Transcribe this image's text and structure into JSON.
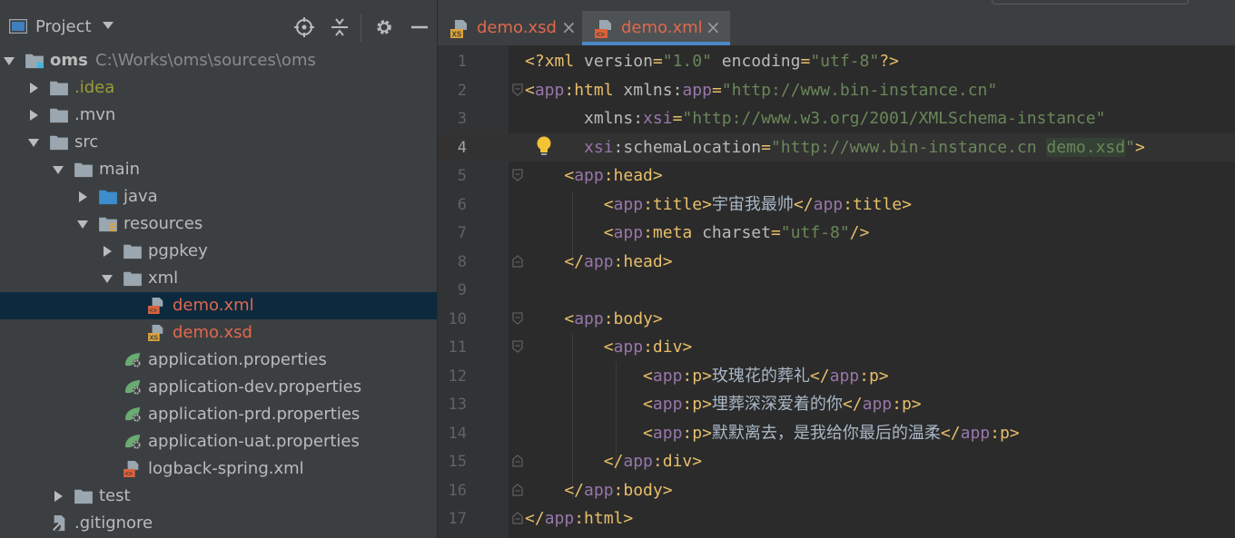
{
  "project_panel": {
    "title": "Project",
    "tree": [
      {
        "label": "oms",
        "path": "C:\\Works\\oms\\sources\\oms",
        "icon": "module-folder-icon",
        "expanded": true
      },
      {
        "label": ".idea",
        "icon": "folder-icon",
        "expanded": false
      },
      {
        "label": ".mvn",
        "icon": "folder-icon",
        "expanded": false
      },
      {
        "label": "src",
        "icon": "folder-icon",
        "expanded": true
      },
      {
        "label": "main",
        "icon": "folder-icon",
        "expanded": true
      },
      {
        "label": "java",
        "icon": "source-folder-icon",
        "expanded": false
      },
      {
        "label": "resources",
        "icon": "resources-folder-icon",
        "expanded": true
      },
      {
        "label": "pgpkey",
        "icon": "folder-icon",
        "expanded": false
      },
      {
        "label": "xml",
        "icon": "folder-icon",
        "expanded": true
      },
      {
        "label": "demo.xml",
        "icon": "xml-file-icon"
      },
      {
        "label": "demo.xsd",
        "icon": "xsd-file-icon"
      },
      {
        "label": "application.properties",
        "icon": "spring-properties-icon"
      },
      {
        "label": "application-dev.properties",
        "icon": "spring-properties-icon"
      },
      {
        "label": "application-prd.properties",
        "icon": "spring-properties-icon"
      },
      {
        "label": "application-uat.properties",
        "icon": "spring-properties-icon"
      },
      {
        "label": "logback-spring.xml",
        "icon": "xml-file-icon"
      },
      {
        "label": "test",
        "icon": "folder-icon",
        "expanded": false
      },
      {
        "label": ".gitignore",
        "icon": "gitignore-file-icon"
      }
    ],
    "selected": "demo.xml"
  },
  "editor": {
    "tabs": [
      {
        "label": "demo.xsd",
        "icon": "xsd-file-icon",
        "close": "×",
        "active": false
      },
      {
        "label": "demo.xml",
        "icon": "xml-file-icon",
        "close": "×",
        "active": true
      }
    ],
    "current_line": 4,
    "lines": [
      {
        "n": "1",
        "tokens": [
          [
            "br",
            "<?"
          ],
          [
            "br",
            "xml "
          ],
          [
            "attr",
            "version"
          ],
          [
            "br",
            "="
          ],
          [
            "val",
            "\"1.0\""
          ],
          [
            "attr",
            " encoding"
          ],
          [
            "br",
            "="
          ],
          [
            "val",
            "\"utf-8\""
          ],
          [
            "br",
            "?>"
          ]
        ]
      },
      {
        "n": "2",
        "tokens": [
          [
            "br",
            "<"
          ],
          [
            "ns",
            "app"
          ],
          [
            "br",
            ":html "
          ],
          [
            "attr",
            "xmlns:"
          ],
          [
            "ns",
            "app"
          ],
          [
            "br",
            "="
          ],
          [
            "val",
            "\"http://www.bin-instance.cn\""
          ]
        ]
      },
      {
        "n": "3",
        "tokens": [
          [
            "attr",
            "      xmlns:"
          ],
          [
            "ns",
            "xsi"
          ],
          [
            "br",
            "="
          ],
          [
            "val",
            "\"http://www.w3.org/2001/XMLSchema-instance\""
          ]
        ]
      },
      {
        "n": "4",
        "tokens": [
          [
            "attr",
            "      "
          ],
          [
            "ns",
            "xsi"
          ],
          [
            "attr",
            ":schemaLocation"
          ],
          [
            "br",
            "="
          ],
          [
            "val",
            "\"http://www.bin-instance.cn "
          ],
          [
            "valhl",
            "demo.xsd"
          ],
          [
            "val",
            "\""
          ],
          [
            "br",
            ">"
          ]
        ]
      },
      {
        "n": "5",
        "tokens": [
          [
            "br",
            "    <"
          ],
          [
            "ns",
            "app"
          ],
          [
            "br",
            ":head>"
          ]
        ]
      },
      {
        "n": "6",
        "tokens": [
          [
            "br",
            "        <"
          ],
          [
            "ns",
            "app"
          ],
          [
            "br",
            ":title>"
          ],
          [
            "txt",
            "宇宙我最帅"
          ],
          [
            "br",
            "</"
          ],
          [
            "ns",
            "app"
          ],
          [
            "br",
            ":title>"
          ]
        ]
      },
      {
        "n": "7",
        "tokens": [
          [
            "br",
            "        <"
          ],
          [
            "ns",
            "app"
          ],
          [
            "br",
            ":meta "
          ],
          [
            "attr",
            "charset"
          ],
          [
            "br",
            "="
          ],
          [
            "val",
            "\"utf-8\""
          ],
          [
            "br",
            "/>"
          ]
        ]
      },
      {
        "n": "8",
        "tokens": [
          [
            "br",
            "    </"
          ],
          [
            "ns",
            "app"
          ],
          [
            "br",
            ":head>"
          ]
        ]
      },
      {
        "n": "9",
        "tokens": []
      },
      {
        "n": "10",
        "tokens": [
          [
            "br",
            "    <"
          ],
          [
            "ns",
            "app"
          ],
          [
            "br",
            ":body>"
          ]
        ]
      },
      {
        "n": "11",
        "tokens": [
          [
            "br",
            "        <"
          ],
          [
            "ns",
            "app"
          ],
          [
            "br",
            ":div>"
          ]
        ]
      },
      {
        "n": "12",
        "tokens": [
          [
            "br",
            "            <"
          ],
          [
            "ns",
            "app"
          ],
          [
            "br",
            ":p>"
          ],
          [
            "txt",
            "玫瑰花的葬礼"
          ],
          [
            "br",
            "</"
          ],
          [
            "ns",
            "app"
          ],
          [
            "br",
            ":p>"
          ]
        ]
      },
      {
        "n": "13",
        "tokens": [
          [
            "br",
            "            <"
          ],
          [
            "ns",
            "app"
          ],
          [
            "br",
            ":p>"
          ],
          [
            "txt",
            "埋葬深深爱着的你"
          ],
          [
            "br",
            "</"
          ],
          [
            "ns",
            "app"
          ],
          [
            "br",
            ":p>"
          ]
        ]
      },
      {
        "n": "14",
        "tokens": [
          [
            "br",
            "            <"
          ],
          [
            "ns",
            "app"
          ],
          [
            "br",
            ":p>"
          ],
          [
            "txt",
            "默默离去，是我给你最后的温柔"
          ],
          [
            "br",
            "</"
          ],
          [
            "ns",
            "app"
          ],
          [
            "br",
            ":p>"
          ]
        ]
      },
      {
        "n": "15",
        "tokens": [
          [
            "br",
            "        </"
          ],
          [
            "ns",
            "app"
          ],
          [
            "br",
            ":div>"
          ]
        ]
      },
      {
        "n": "16",
        "tokens": [
          [
            "br",
            "    </"
          ],
          [
            "ns",
            "app"
          ],
          [
            "br",
            ":body>"
          ]
        ]
      },
      {
        "n": "17",
        "tokens": [
          [
            "br",
            "</"
          ],
          [
            "ns",
            "app"
          ],
          [
            "br",
            ":html>"
          ]
        ]
      }
    ]
  },
  "colors": {
    "panel_bg": "#3c3f41",
    "editor_bg": "#2b2b2b",
    "selection": "#0d293e",
    "tag": "#e8bf6a",
    "namespace": "#9876aa",
    "string": "#6a8759",
    "modified_file": "#e0684e"
  }
}
